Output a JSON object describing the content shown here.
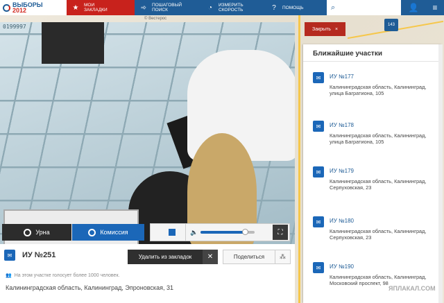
{
  "header": {
    "logo_line1": "ВЫБОРЫ",
    "logo_line2": "2012",
    "tabs": [
      {
        "label_1": "МОИ",
        "label_2": "ЗАКЛАДКИ",
        "icon": "star-icon"
      },
      {
        "label_1": "ПОШАГОВЫЙ",
        "label_2": "ПОИСК",
        "icon": "steps-icon"
      },
      {
        "label_1": "ИЗМЕРИТЬ",
        "label_2": "СКОРОСТЬ",
        "icon": "speed-icon"
      },
      {
        "label_1": "ПОМОЩЬ",
        "label_2": "",
        "icon": "help-icon"
      }
    ]
  },
  "map": {
    "copyright": "© Вестерос"
  },
  "video": {
    "camera_id": "0199997",
    "tabs": {
      "urn": "Урна",
      "commission": "Комиссия"
    },
    "volume": 0.82
  },
  "station": {
    "title": "ИУ №251",
    "remove_bookmark": "Удалить из закладок",
    "share": "Поделиться",
    "note": "На этом участке голосует более 1000 человек.",
    "address": "Калининградская область, Калининград, Эпроновская, 31"
  },
  "panel": {
    "close_label": "Закрыть",
    "map_badge": "143",
    "title": "Ближайшие участки",
    "stations": [
      {
        "name": "ИУ №177",
        "address": "Калининградская область, Калининград, улица Багратиона, 105"
      },
      {
        "name": "ИУ №178",
        "address": "Калининградская область, Калининград, улица Багратиона, 105"
      },
      {
        "name": "ИУ №179",
        "address": "Калининградская область, Калининград, Серпуховская, 23"
      },
      {
        "name": "ИУ №180",
        "address": "Калининградская область, Калининград, Серпуховская, 23"
      },
      {
        "name": "ИУ №190",
        "address": "Калининградская область, Калининград, Московский проспект, 98"
      }
    ]
  },
  "watermark": "ЯПЛАКАЛ.COM",
  "colors": {
    "brand_blue": "#1f5c96",
    "accent_red": "#c8221c",
    "button_blue": "#1b67b8"
  }
}
